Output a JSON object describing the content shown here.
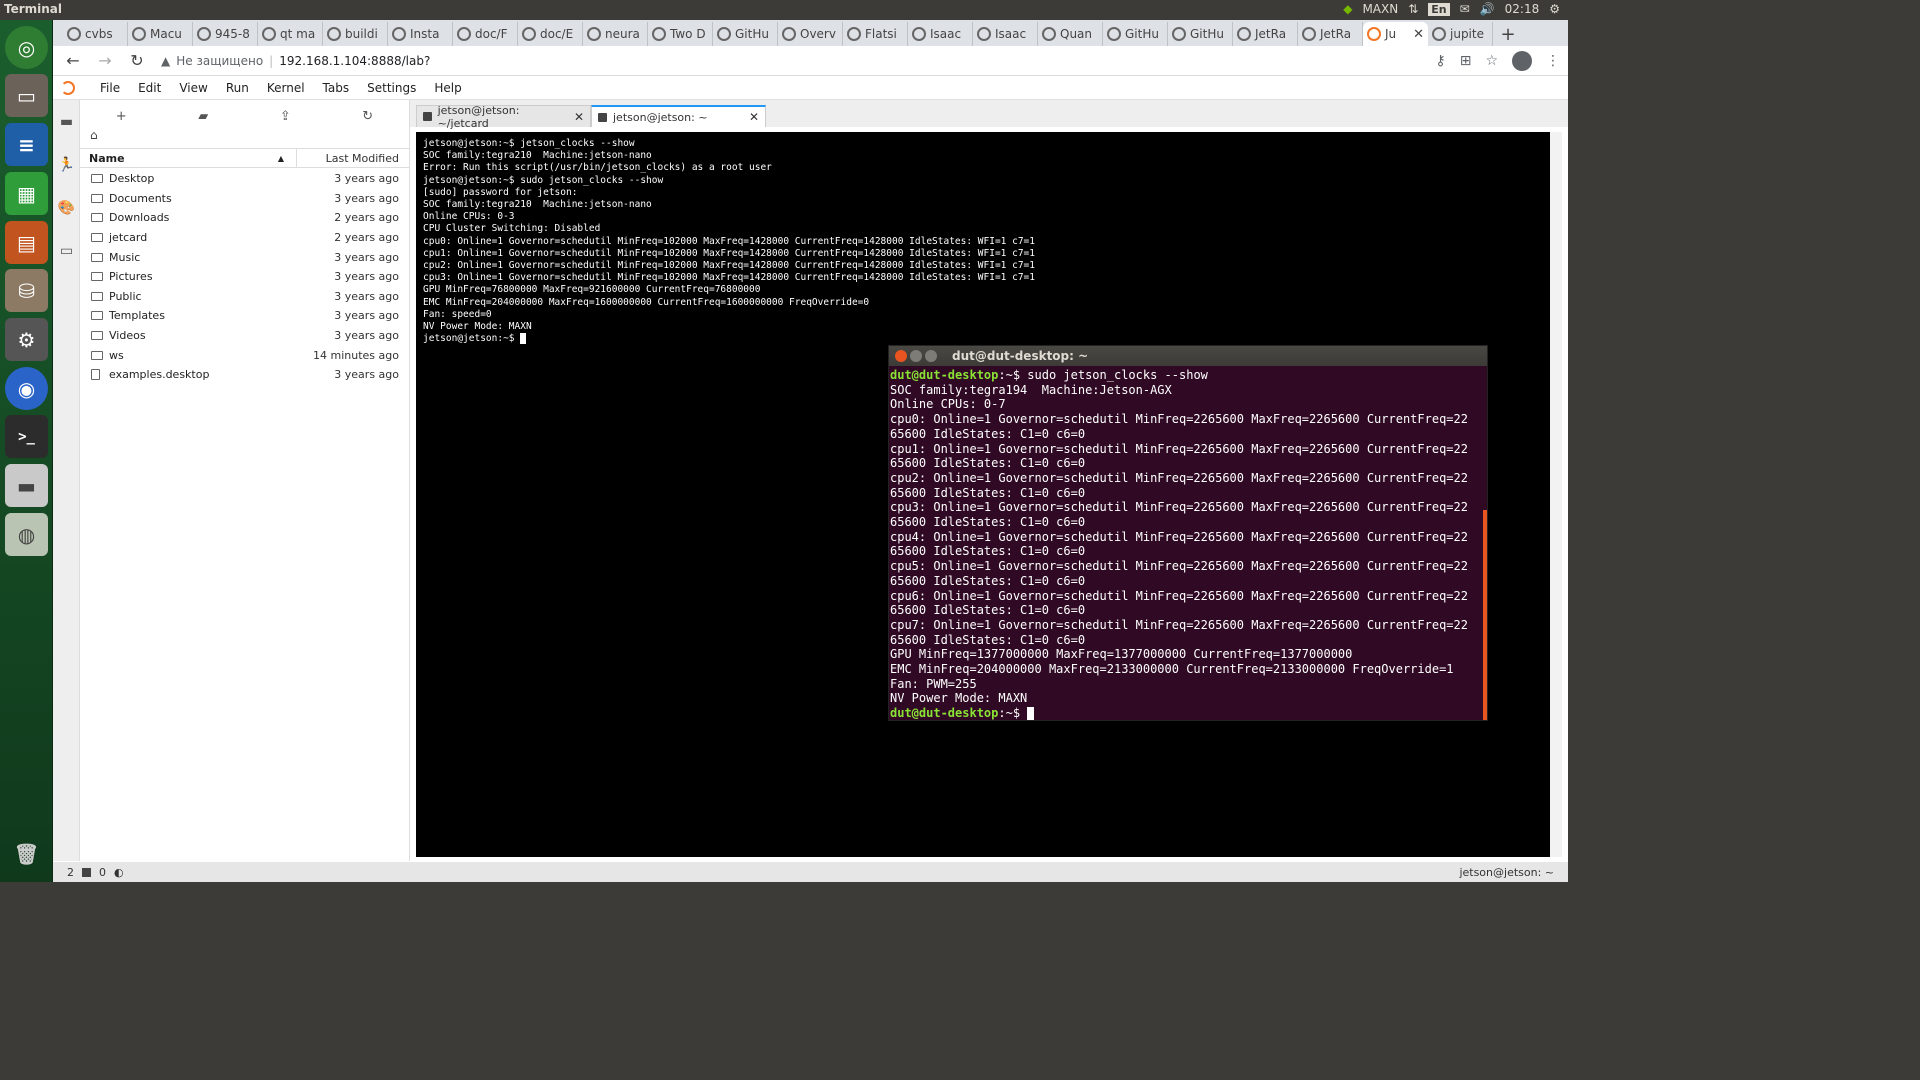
{
  "topbar": {
    "app_name": "Terminal",
    "power_mode": "MAXN",
    "keyboard": "En",
    "clock": "02:18"
  },
  "browser": {
    "tabs": [
      {
        "label": "cvbs"
      },
      {
        "label": "Macu"
      },
      {
        "label": "945-8"
      },
      {
        "label": "qt ma"
      },
      {
        "label": "buildi"
      },
      {
        "label": "Insta"
      },
      {
        "label": "doc/F"
      },
      {
        "label": "doc/E"
      },
      {
        "label": "neura"
      },
      {
        "label": "Two D"
      },
      {
        "label": "GitHu"
      },
      {
        "label": "Overv"
      },
      {
        "label": "Flatsi"
      },
      {
        "label": "Isaac"
      },
      {
        "label": "Isaac"
      },
      {
        "label": "Quan"
      },
      {
        "label": "GitHu"
      },
      {
        "label": "GitHu"
      },
      {
        "label": "JetRa"
      },
      {
        "label": "JetRa"
      },
      {
        "label": "Ju"
      },
      {
        "label": "jupite"
      }
    ],
    "insecure_label": "Не защищено",
    "url": "192.168.1.104:8888/lab?"
  },
  "jupyter": {
    "menu": [
      "File",
      "Edit",
      "View",
      "Run",
      "Kernel",
      "Tabs",
      "Settings",
      "Help"
    ],
    "filebrowser": {
      "col_name": "Name",
      "col_modified": "Last Modified",
      "rows": [
        {
          "name": "Desktop",
          "modified": "3 years ago"
        },
        {
          "name": "Documents",
          "modified": "3 years ago"
        },
        {
          "name": "Downloads",
          "modified": "2 years ago"
        },
        {
          "name": "jetcard",
          "modified": "2 years ago"
        },
        {
          "name": "Music",
          "modified": "3 years ago"
        },
        {
          "name": "Pictures",
          "modified": "3 years ago"
        },
        {
          "name": "Public",
          "modified": "3 years ago"
        },
        {
          "name": "Templates",
          "modified": "3 years ago"
        },
        {
          "name": "Videos",
          "modified": "3 years ago"
        },
        {
          "name": "ws",
          "modified": "14 minutes ago"
        },
        {
          "name": "examples.desktop",
          "modified": "3 years ago"
        }
      ]
    },
    "doc_tabs": [
      {
        "label": "jetson@jetson: ~/jetcard"
      },
      {
        "label": "jetson@jetson: ~"
      }
    ],
    "terminal_text": "jetson@jetson:~$ jetson_clocks --show\nSOC family:tegra210  Machine:jetson-nano\nError: Run this script(/usr/bin/jetson_clocks) as a root user\njetson@jetson:~$ sudo jetson_clocks --show\n[sudo] password for jetson:\nSOC family:tegra210  Machine:jetson-nano\nOnline CPUs: 0-3\nCPU Cluster Switching: Disabled\ncpu0: Online=1 Governor=schedutil MinFreq=102000 MaxFreq=1428000 CurrentFreq=1428000 IdleStates: WFI=1 c7=1\ncpu1: Online=1 Governor=schedutil MinFreq=102000 MaxFreq=1428000 CurrentFreq=1428000 IdleStates: WFI=1 c7=1\ncpu2: Online=1 Governor=schedutil MinFreq=102000 MaxFreq=1428000 CurrentFreq=1428000 IdleStates: WFI=1 c7=1\ncpu3: Online=1 Governor=schedutil MinFreq=102000 MaxFreq=1428000 CurrentFreq=1428000 IdleStates: WFI=1 c7=1\nGPU MinFreq=76800000 MaxFreq=921600000 CurrentFreq=76800000\nEMC MinFreq=204000000 MaxFreq=1600000000 CurrentFreq=1600000000 FreqOverride=0\nFan: speed=0\nNV Power Mode: MAXN\n",
    "terminal_prompt": "jetson@jetson:~$ ",
    "status_left_count": "2",
    "status_kernels": "0",
    "status_right": "jetson@jetson: ~"
  },
  "ubuntu_terminal": {
    "title": "dut@dut-desktop: ~",
    "prompt": "dut@dut-desktop",
    "prompt_suffix": ":~$ ",
    "command": "sudo jetson_clocks --show",
    "output": "SOC family:tegra194  Machine:Jetson-AGX\nOnline CPUs: 0-7\ncpu0: Online=1 Governor=schedutil MinFreq=2265600 MaxFreq=2265600 CurrentFreq=22\n65600 IdleStates: C1=0 c6=0\ncpu1: Online=1 Governor=schedutil MinFreq=2265600 MaxFreq=2265600 CurrentFreq=22\n65600 IdleStates: C1=0 c6=0\ncpu2: Online=1 Governor=schedutil MinFreq=2265600 MaxFreq=2265600 CurrentFreq=22\n65600 IdleStates: C1=0 c6=0\ncpu3: Online=1 Governor=schedutil MinFreq=2265600 MaxFreq=2265600 CurrentFreq=22\n65600 IdleStates: C1=0 c6=0\ncpu4: Online=1 Governor=schedutil MinFreq=2265600 MaxFreq=2265600 CurrentFreq=22\n65600 IdleStates: C1=0 c6=0\ncpu5: Online=1 Governor=schedutil MinFreq=2265600 MaxFreq=2265600 CurrentFreq=22\n65600 IdleStates: C1=0 c6=0\ncpu6: Online=1 Governor=schedutil MinFreq=2265600 MaxFreq=2265600 CurrentFreq=22\n65600 IdleStates: C1=0 c6=0\ncpu7: Online=1 Governor=schedutil MinFreq=2265600 MaxFreq=2265600 CurrentFreq=22\n65600 IdleStates: C1=0 c6=0\nGPU MinFreq=1377000000 MaxFreq=1377000000 CurrentFreq=1377000000\nEMC MinFreq=204000000 MaxFreq=2133000000 CurrentFreq=2133000000 FreqOverride=1\nFan: PWM=255\nNV Power Mode: MAXN"
  },
  "colors": {
    "ubuntu_term_bg": "#300a24",
    "prompt_green": "#8ae234",
    "accent_orange": "#e95420",
    "jupyter_orange": "#f37726"
  }
}
